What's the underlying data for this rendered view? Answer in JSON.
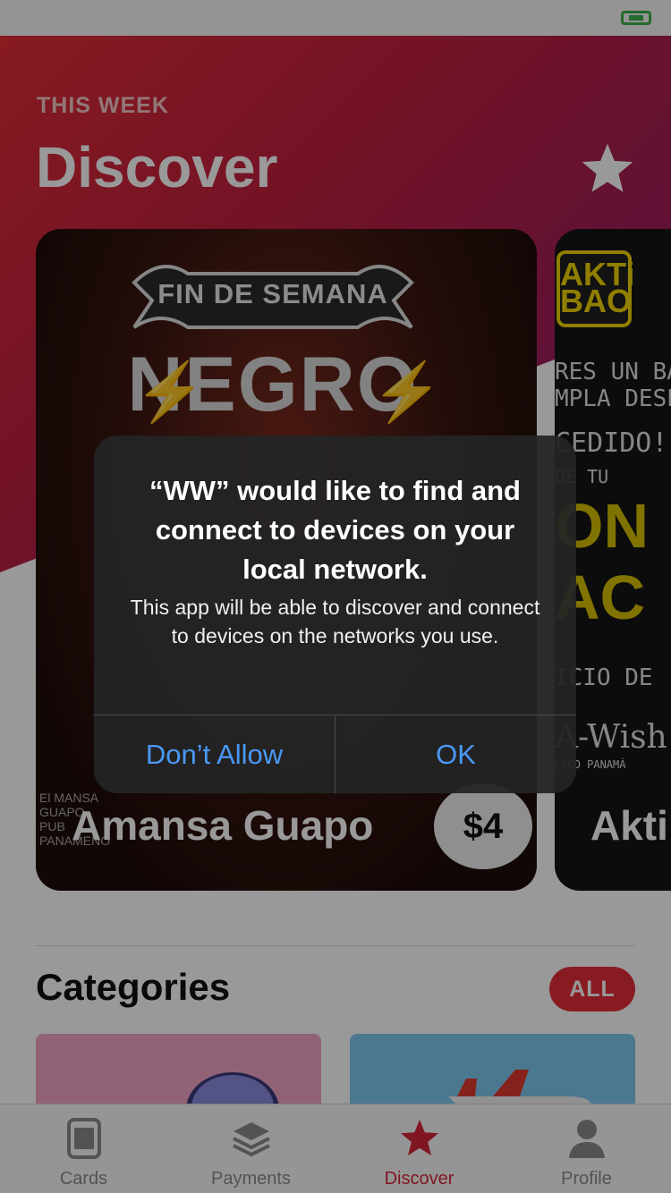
{
  "status_bar": {
    "battery_icon": "battery-icon",
    "battery_color": "#3fb14b"
  },
  "header": {
    "kicker": "THIS WEEK",
    "title": "Discover",
    "favorite_icon": "star-icon"
  },
  "featured": [
    {
      "banner": "FIN DE SEMANA",
      "headline": "NEGRO",
      "name": "Amansa Guapo",
      "price": "$4",
      "venue_logo": "El MANSA GUAPO PUB PANAMEÑO"
    },
    {
      "logo": "AKTi BAO",
      "lines": [
        "RES UN BAO",
        "MPLA DESEOS",
        "CEDIDO!",
        "DE TU",
        "ICIO DE"
      ],
      "yellow_text": [
        "ON",
        "AC"
      ],
      "footer": "A-Wish",
      "footer_sub": "ESEO PANAMÁ",
      "name": "Akti"
    }
  ],
  "categories": {
    "title": "Categories",
    "all_label": "ALL",
    "tiles": [
      {
        "icon": "donut-icon",
        "color": "#f2a3c5"
      },
      {
        "icon": "airplane-icon",
        "color": "#7fc9ef"
      }
    ]
  },
  "tabs": [
    {
      "label": "Cards",
      "icon": "card-icon",
      "active": false
    },
    {
      "label": "Payments",
      "icon": "layers-icon",
      "active": false
    },
    {
      "label": "Discover",
      "icon": "star-icon",
      "active": true
    },
    {
      "label": "Profile",
      "icon": "person-icon",
      "active": false
    }
  ],
  "alert": {
    "title": "“WW” would like to find and connect to devices on your local network.",
    "message": "This app will be able to discover and connect to devices on the networks you use.",
    "deny_label": "Don’t Allow",
    "ok_label": "OK"
  },
  "colors": {
    "accent": "#e32d3a",
    "link": "#4a98f5"
  }
}
